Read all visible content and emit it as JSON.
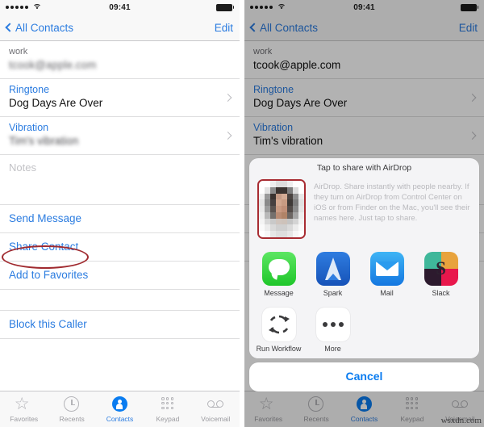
{
  "status_bar": {
    "time": "09:41",
    "signal_dots": 5,
    "wifi_icon": "wifi-icon",
    "battery_icon": "battery-full-icon"
  },
  "nav": {
    "back_label": "All Contacts",
    "back_icon": "chevron-left-icon",
    "edit_label": "Edit"
  },
  "contact": {
    "email_label": "work",
    "email_value_left": "tcook@apple.com",
    "email_value_right": "tcook@apple.com",
    "ringtone_label": "Ringtone",
    "ringtone_value": "Dog Days Are Over",
    "vibration_label": "Vibration",
    "vibration_value": "Tim's vibration",
    "notes_placeholder": "Notes",
    "actions": [
      {
        "label": "Send Message",
        "name": "send-message-action"
      },
      {
        "label": "Share Contact",
        "name": "share-contact-action",
        "highlighted": true
      },
      {
        "label": "Add to Favorites",
        "name": "add-to-favorites-action"
      },
      {
        "label": "Block this Caller",
        "name": "block-this-caller-action"
      }
    ]
  },
  "tabbar": {
    "items": [
      {
        "label": "Favorites",
        "icon": "star-icon",
        "active": false
      },
      {
        "label": "Recents",
        "icon": "clock-icon",
        "active": false
      },
      {
        "label": "Contacts",
        "icon": "contact-icon",
        "active": true
      },
      {
        "label": "Keypad",
        "icon": "keypad-icon",
        "active": false
      },
      {
        "label": "Voicemail",
        "icon": "voicemail-icon",
        "active": false
      }
    ]
  },
  "share_sheet": {
    "title": "Tap to share with AirDrop",
    "airdrop_help": "AirDrop. Share instantly with people nearby. If they turn on AirDrop from Control Center on iOS or from Finder on the Mac, you'll see their names here. Just tap to share.",
    "airdrop_avatar_name": "airdrop-contact-avatar",
    "apps": [
      {
        "label": "Message",
        "icon": "messages-app-icon"
      },
      {
        "label": "Spark",
        "icon": "spark-app-icon"
      },
      {
        "label": "Mail",
        "icon": "mail-app-icon"
      },
      {
        "label": "Slack",
        "icon": "slack-app-icon"
      }
    ],
    "actions": [
      {
        "label": "Run Workflow",
        "icon": "refresh-icon"
      },
      {
        "label": "More",
        "icon": "ellipsis-icon"
      }
    ],
    "cancel_label": "Cancel"
  },
  "colors": {
    "accent_blue": "#2b7ce0",
    "tab_active_blue": "#0a7cf0",
    "annotation_red": "#a02a2f",
    "bar_bg": "#f8f8f8"
  },
  "watermark": "wsxdn.com"
}
